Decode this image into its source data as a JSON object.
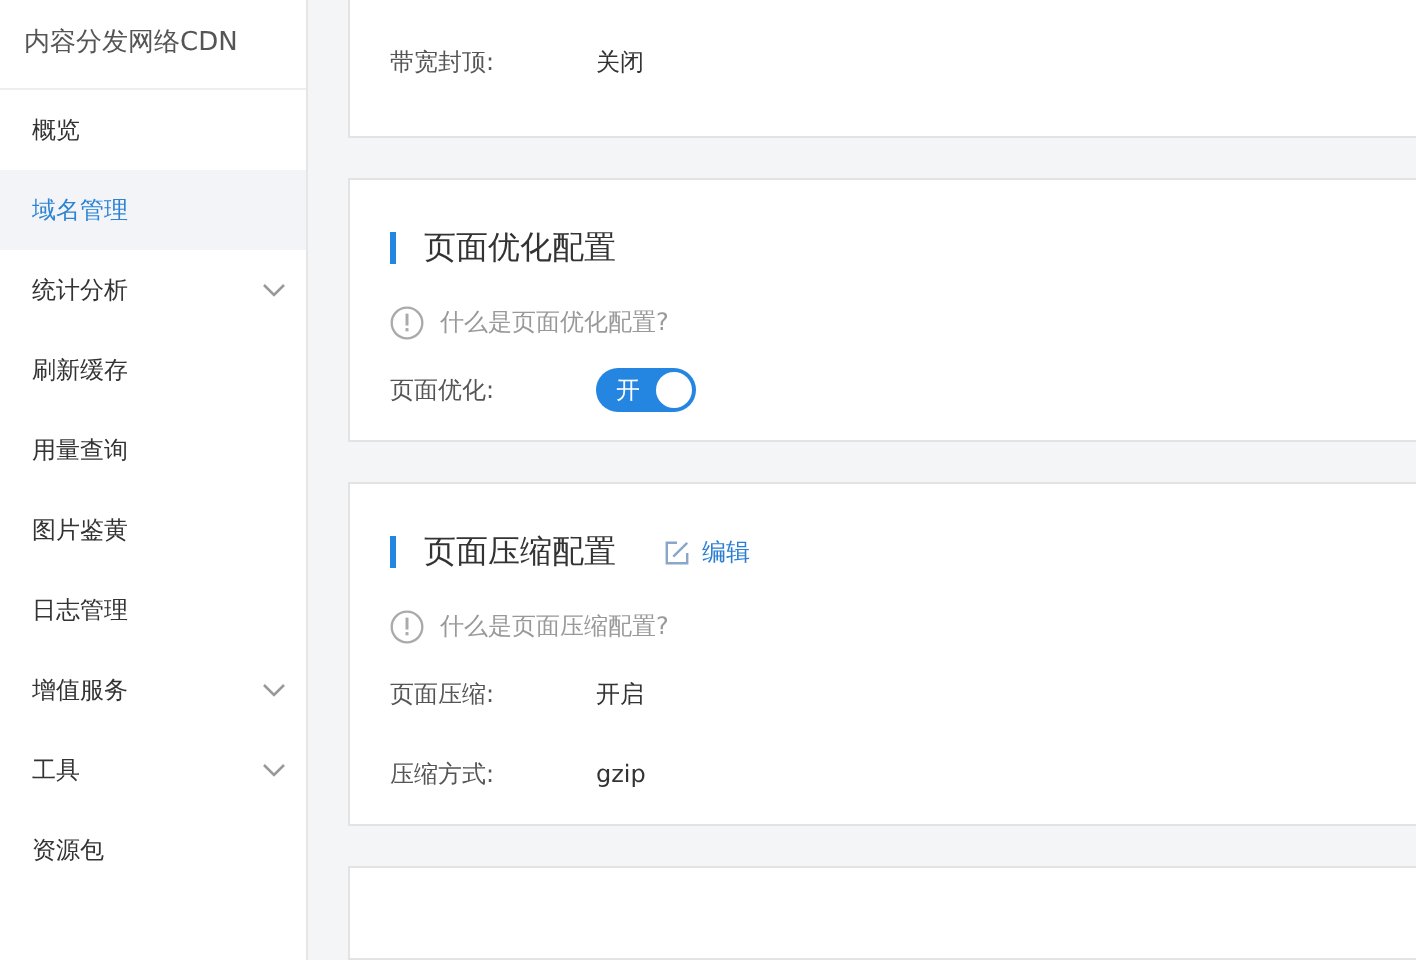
{
  "sidebar": {
    "title": "内容分发网络CDN",
    "items": [
      {
        "label": "概览",
        "selected": false,
        "expandable": false
      },
      {
        "label": "域名管理",
        "selected": true,
        "expandable": false
      },
      {
        "label": "统计分析",
        "selected": false,
        "expandable": true
      },
      {
        "label": "刷新缓存",
        "selected": false,
        "expandable": false
      },
      {
        "label": "用量查询",
        "selected": false,
        "expandable": false
      },
      {
        "label": "图片鉴黄",
        "selected": false,
        "expandable": false
      },
      {
        "label": "日志管理",
        "selected": false,
        "expandable": false
      },
      {
        "label": "增值服务",
        "selected": false,
        "expandable": true
      },
      {
        "label": "工具",
        "selected": false,
        "expandable": true
      },
      {
        "label": "资源包",
        "selected": false,
        "expandable": false
      }
    ]
  },
  "sections": [
    {
      "rows": [
        {
          "kind": "text",
          "label": "带宽封顶:",
          "value": "关闭"
        }
      ]
    },
    {
      "title": "页面优化配置",
      "help": "什么是页面优化配置?",
      "rows": [
        {
          "kind": "toggle",
          "label": "页面优化:",
          "on": true,
          "text": "开"
        }
      ]
    },
    {
      "title": "页面压缩配置",
      "edit": "编辑",
      "help": "什么是页面压缩配置?",
      "rows": [
        {
          "kind": "text",
          "label": "页面压缩:",
          "value": "开启"
        },
        {
          "kind": "text",
          "label": "压缩方式:",
          "value": "gzip"
        }
      ]
    }
  ]
}
